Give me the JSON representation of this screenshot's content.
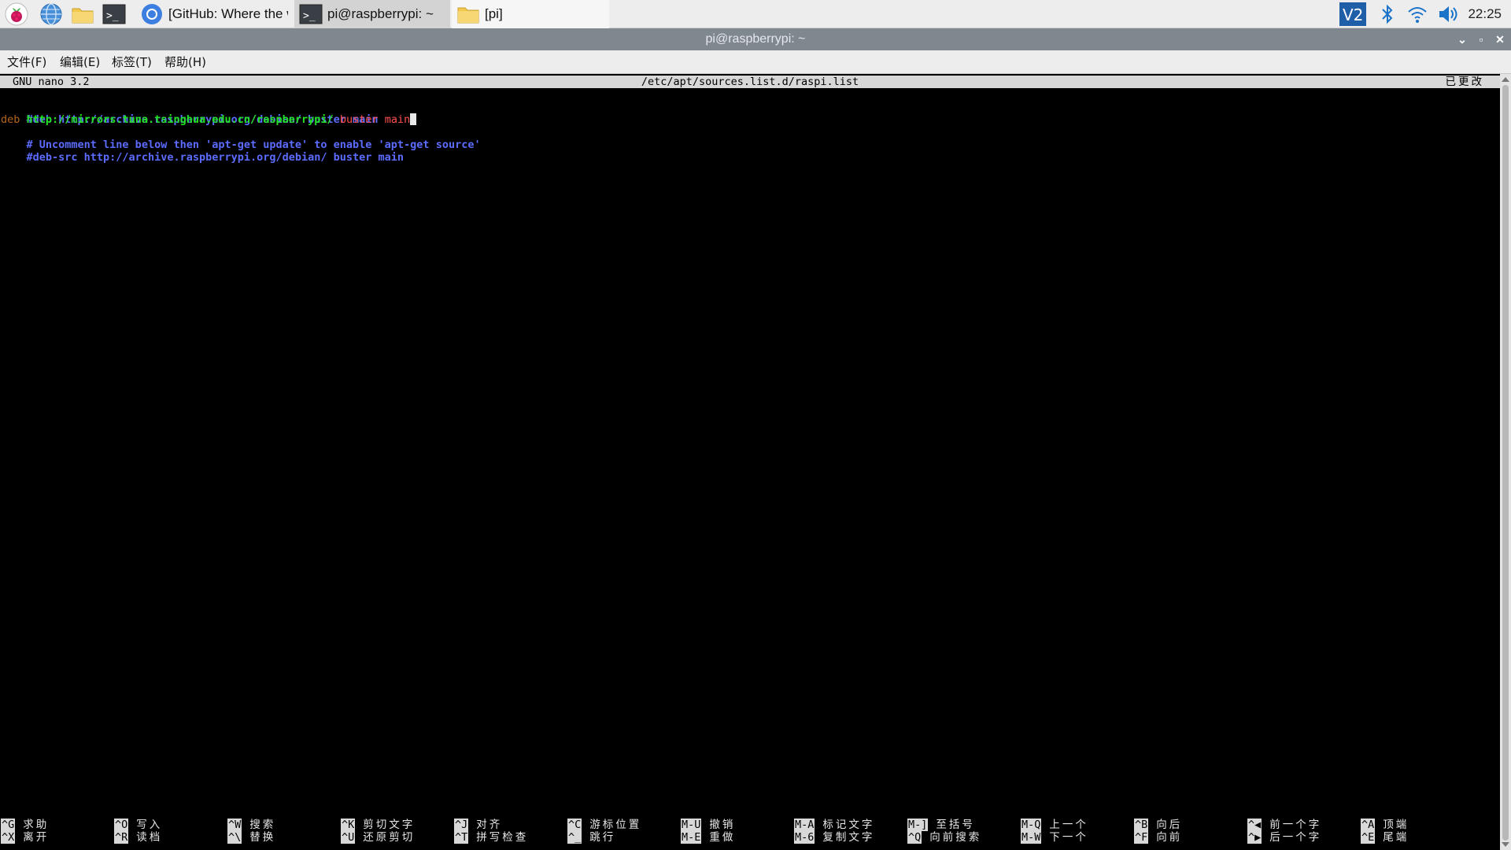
{
  "taskbar": {
    "tasks": [
      {
        "label": "[GitHub: Where the w...",
        "icon": "chromium-icon"
      },
      {
        "label": "pi@raspberrypi: ~",
        "icon": "terminal-icon"
      },
      {
        "label": "[pi]",
        "icon": "folder-icon"
      }
    ],
    "vnc_label": "V2",
    "clock": "22:25"
  },
  "window": {
    "title": "pi@raspberrypi: ~"
  },
  "menubar": {
    "items": [
      "文件(F)",
      "编辑(E)",
      "标签(T)",
      "帮助(H)"
    ]
  },
  "nano": {
    "version": "GNU nano 3.2",
    "filename": "/etc/apt/sources.list.d/raspi.list",
    "modified": "已更改",
    "lines": {
      "l1": "#deb http://archive.raspberrypi.org/debian/ buster main",
      "l2_type": "deb",
      "l2_url": "http://mirrors.tuna.tsinghua.edu.cn/raspberrypi/",
      "l2_dist": "buster main",
      "l3": "# Uncomment line below then 'apt-get update' to enable 'apt-get source'",
      "l4": "#deb-src http://archive.raspberrypi.org/debian/ buster main"
    },
    "shortcuts": [
      [
        {
          "key": "^G",
          "label": "求助"
        },
        {
          "key": "^X",
          "label": "离开"
        }
      ],
      [
        {
          "key": "^O",
          "label": "写入"
        },
        {
          "key": "^R",
          "label": "读档"
        }
      ],
      [
        {
          "key": "^W",
          "label": "搜索"
        },
        {
          "key": "^\\",
          "label": "替换"
        }
      ],
      [
        {
          "key": "^K",
          "label": "剪切文字"
        },
        {
          "key": "^U",
          "label": "还原剪切"
        }
      ],
      [
        {
          "key": "^J",
          "label": "对齐"
        },
        {
          "key": "^T",
          "label": "拼写检查"
        }
      ],
      [
        {
          "key": "^C",
          "label": "游标位置"
        },
        {
          "key": "^_",
          "label": "跳行"
        }
      ],
      [
        {
          "key": "M-U",
          "label": "撤销"
        },
        {
          "key": "M-E",
          "label": "重做"
        }
      ],
      [
        {
          "key": "M-A",
          "label": "标记文字"
        },
        {
          "key": "M-6",
          "label": "复制文字"
        }
      ],
      [
        {
          "key": "M-]",
          "label": "至括号"
        },
        {
          "key": "^Q",
          "label": "向前搜索"
        }
      ],
      [
        {
          "key": "M-Q",
          "label": "上一个"
        },
        {
          "key": "M-W",
          "label": "下一个"
        }
      ],
      [
        {
          "key": "^B",
          "label": "向后"
        },
        {
          "key": "^F",
          "label": "向前"
        }
      ],
      [
        {
          "key": "^◀",
          "label": "前一个字"
        },
        {
          "key": "^▶",
          "label": "后一个字"
        }
      ],
      [
        {
          "key": "^A",
          "label": "顶端"
        },
        {
          "key": "^E",
          "label": "尾端"
        }
      ]
    ]
  },
  "colors": {
    "comment": "#5b6cff",
    "url": "#22e022",
    "dist": "#ff5050",
    "deb": "#b5651d",
    "titlebar": "#7f878f"
  }
}
